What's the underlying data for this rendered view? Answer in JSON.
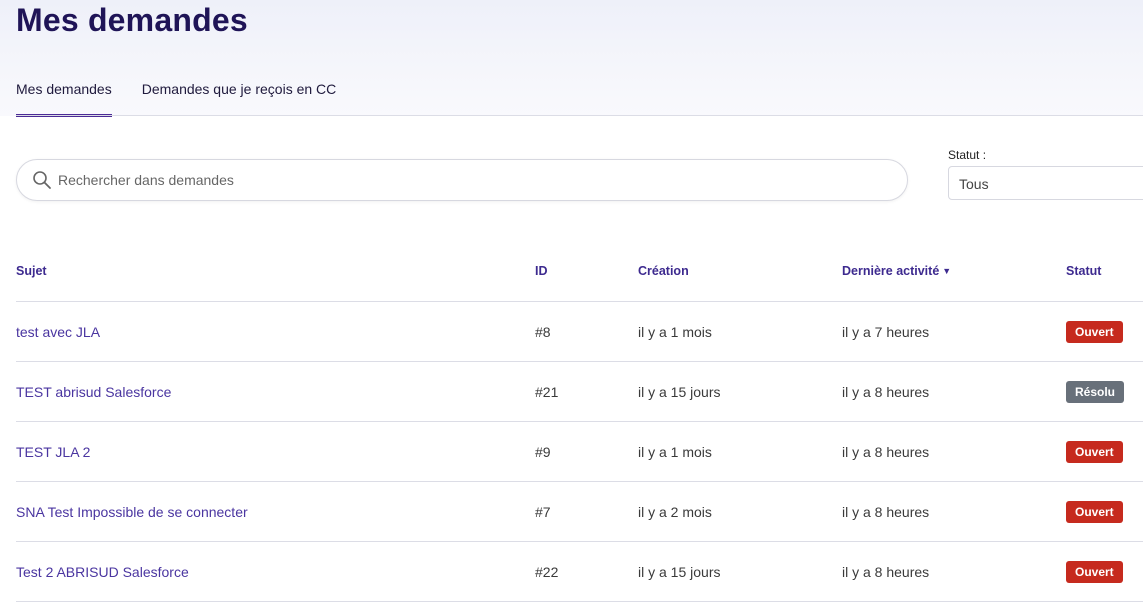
{
  "page": {
    "title": "Mes demandes"
  },
  "tabs": [
    {
      "label": "Mes demandes",
      "active": true
    },
    {
      "label": "Demandes que je reçois en CC",
      "active": false
    }
  ],
  "search": {
    "placeholder": "Rechercher dans demandes",
    "value": "",
    "icon": "search-icon"
  },
  "filter": {
    "label": "Statut :",
    "selected": "Tous"
  },
  "table": {
    "columns": {
      "subject": "Sujet",
      "id": "ID",
      "created": "Création",
      "activity": "Dernière activité",
      "activity_sort": "▼",
      "status": "Statut"
    },
    "rows": [
      {
        "subject": "test avec JLA",
        "id": "#8",
        "created": "il y a 1 mois",
        "activity": "il y a 7 heures",
        "status": "Ouvert",
        "status_type": "open"
      },
      {
        "subject": "TEST abrisud Salesforce",
        "id": "#21",
        "created": "il y a 15 jours",
        "activity": "il y a 8 heures",
        "status": "Résolu",
        "status_type": "resolved"
      },
      {
        "subject": "TEST JLA 2",
        "id": "#9",
        "created": "il y a 1 mois",
        "activity": "il y a 8 heures",
        "status": "Ouvert",
        "status_type": "open"
      },
      {
        "subject": "SNA Test Impossible de se connecter",
        "id": "#7",
        "created": "il y a 2 mois",
        "activity": "il y a 8 heures",
        "status": "Ouvert",
        "status_type": "open"
      },
      {
        "subject": "Test 2 ABRISUD Salesforce",
        "id": "#22",
        "created": "il y a 15 jours",
        "activity": "il y a 8 heures",
        "status": "Ouvert",
        "status_type": "open"
      }
    ]
  },
  "colors": {
    "title": "#1f1457",
    "accent": "#4b2b96",
    "link": "#4a35a0",
    "status_open": "#c62a1e",
    "status_resolved": "#68707a"
  }
}
